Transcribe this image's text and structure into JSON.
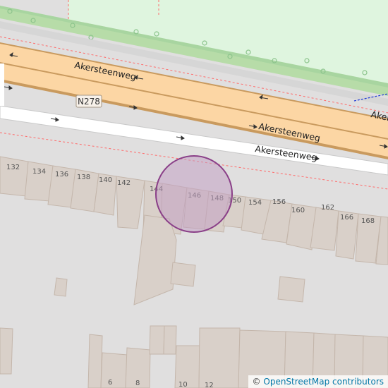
{
  "map": {
    "road_labels": [
      "Akersteenweg",
      "Akersteenweg",
      "Akersteenweg",
      "Akersteenweg"
    ],
    "route_ref": "N278",
    "house_numbers": [
      "132",
      "134",
      "136",
      "138",
      "140",
      "142",
      "144",
      "146",
      "148",
      "150",
      "154",
      "156",
      "160",
      "162",
      "166",
      "168",
      "6",
      "8",
      "10",
      "12"
    ],
    "colors": {
      "background": "#e0dfdf",
      "park": "#dff5df",
      "grass": "#a8d5a0",
      "road_primary": "#fcd6a4",
      "road_casing": "#c99a5e",
      "road_secondary": "#ffffff",
      "building": "#d9d0c9",
      "building_outline": "#c4b6ab",
      "marker_fill": "#c3a1c3",
      "marker_stroke": "#8a3f88",
      "boundary": "#ff6b6b"
    },
    "attribution": {
      "symbol": "©",
      "link_text": "OpenStreetMap contributors"
    }
  }
}
